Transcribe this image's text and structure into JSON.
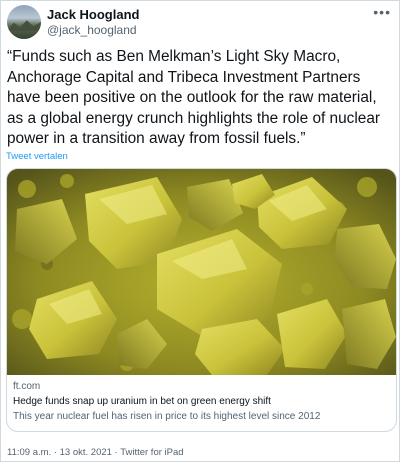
{
  "author": {
    "name": "Jack Hoogland",
    "handle": "@jack_hoogland"
  },
  "tweet": {
    "text": "“Funds such as Ben Melkman’s Light Sky Macro, Anchorage Capital and Tribeca Investment Partners have been positive on the outlook for the raw material, as a global energy crunch highlights the role of nuclear power in a transition away from fossil fuels.”",
    "translate_label": "Tweet vertalen"
  },
  "card": {
    "domain": "ft.com",
    "title": "Hedge funds snap up uranium in bet on green energy shift",
    "description": "This year nuclear fuel has risen in price to its highest level since 2012"
  },
  "meta": {
    "timestamp": "11:09 a.m. · 13 okt. 2021 · Twitter for iPad"
  },
  "icons": {
    "more": "more-options-icon"
  },
  "colors": {
    "link": "#1d9bf0",
    "secondary_text": "#536471",
    "border": "#cfd9de"
  }
}
